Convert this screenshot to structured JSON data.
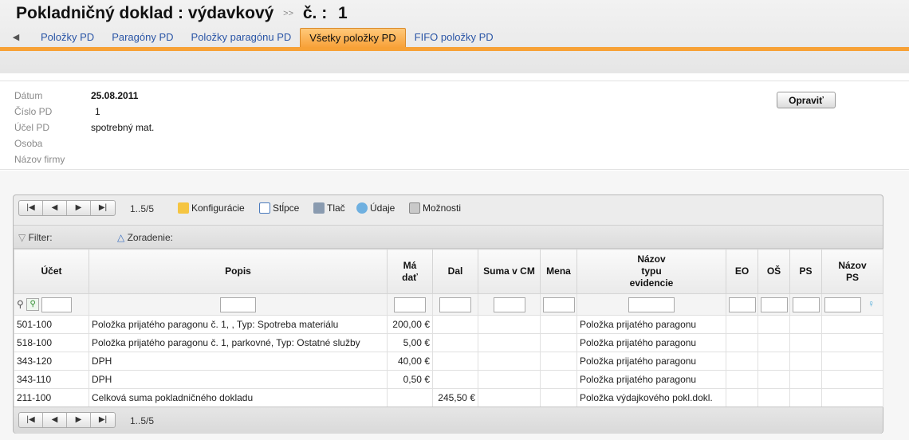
{
  "header": {
    "title_main": "Pokladničný doklad :",
    "title_type": "výdavkový",
    "separator": ">>",
    "title_num_label": "č. :",
    "title_num": "1"
  },
  "tabs": [
    {
      "label": "Položky PD",
      "active": false
    },
    {
      "label": "Paragóny PD",
      "active": false
    },
    {
      "label": "Položky paragónu PD",
      "active": false
    },
    {
      "label": "Všetky položky PD",
      "active": true
    },
    {
      "label": "FIFO položky PD",
      "active": false
    }
  ],
  "info": {
    "rows": [
      {
        "label": "Dátum",
        "value": "25.08.2011"
      },
      {
        "label": "Číslo PD",
        "value": "1"
      },
      {
        "label": "Účel PD",
        "value": "spotrebný mat."
      },
      {
        "label": "Osoba",
        "value": ""
      },
      {
        "label": "Názov firmy",
        "value": ""
      }
    ],
    "edit_label": "Opraviť"
  },
  "toolbar": {
    "page_info": "1..5/5",
    "config": "Konfigurácie",
    "columns": "Stĺpce",
    "print": "Tlač",
    "data": "Údaje",
    "options": "Možnosti",
    "filter": "Filter:",
    "sort": "Zoradenie:"
  },
  "table": {
    "headers": [
      "Účet",
      "Popis",
      "Má dať",
      "Dal",
      "Suma v CM",
      "Mena",
      "Názov typu evidencie",
      "EO",
      "OŠ",
      "PS",
      "Názov PS"
    ],
    "rows": [
      {
        "ucet": "501-100",
        "popis": "Položka prijatého paragonu č. 1, , Typ: Spotreba materiálu",
        "ma_dat": "200,00 €",
        "dal": "",
        "suma": "",
        "mena": "",
        "typ": "Položka prijatého paragonu"
      },
      {
        "ucet": "518-100",
        "popis": "Položka prijatého paragonu č. 1, parkovné, Typ: Ostatné služby",
        "ma_dat": "5,00 €",
        "dal": "",
        "suma": "",
        "mena": "",
        "typ": "Položka prijatého paragonu"
      },
      {
        "ucet": "343-120",
        "popis": "DPH",
        "ma_dat": "40,00 €",
        "dal": "",
        "suma": "",
        "mena": "",
        "typ": "Položka prijatého paragonu"
      },
      {
        "ucet": "343-110",
        "popis": "DPH",
        "ma_dat": "0,50 €",
        "dal": "",
        "suma": "",
        "mena": "",
        "typ": "Položka prijatého paragonu"
      },
      {
        "ucet": "211-100",
        "popis": "Celková suma pokladničného dokladu",
        "ma_dat": "",
        "dal": "245,50 €",
        "suma": "",
        "mena": "",
        "typ": "Položka výdajkového pokl.dokl."
      }
    ]
  },
  "colors": {
    "accent": "#f7a136",
    "link": "#2a55a6"
  }
}
